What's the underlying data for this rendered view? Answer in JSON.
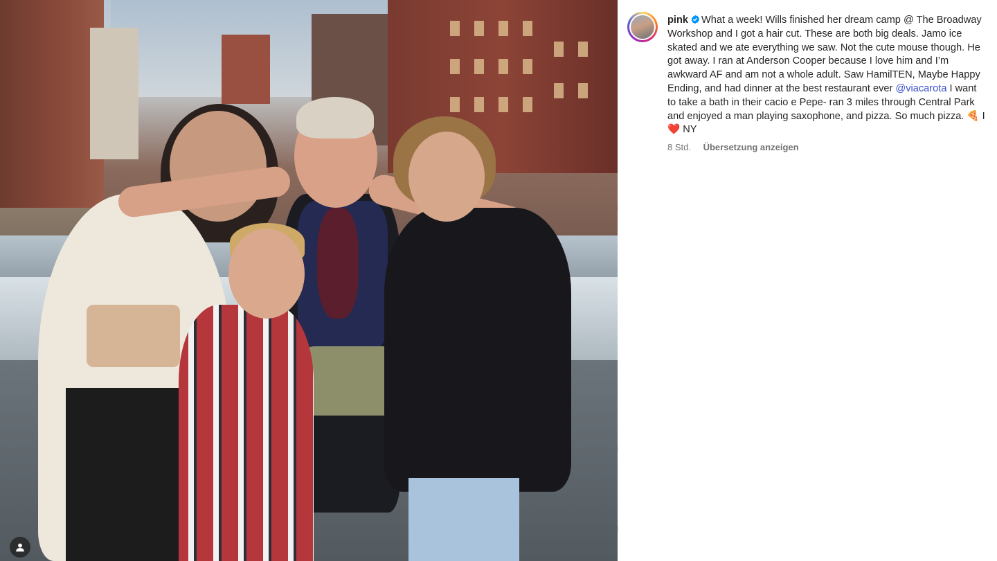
{
  "post": {
    "username": "pink",
    "verified": true,
    "caption_part1": "What a week! Wills finished her dream camp @ The Broadway Workshop and I got a hair cut. These are both big deals. Jamo ice skated and we ate everything we saw. Not the cute mouse though. He got away. I ran at Anderson Cooper because I love him and I’m awkward AF and am not a whole adult. Saw HamilTEN, Maybe Happy Ending, and had dinner at the best restaurant ever ",
    "mention": "@viacarota",
    "caption_part2": " I want to take a bath in their cacio e Pepe- ran 3 miles through Central Park and enjoyed a man playing saxophone, and pizza. So much pizza. ",
    "emoji_pizza": "🍕",
    "caption_i": " I ",
    "emoji_heart": "❤️",
    "caption_end": " NY",
    "timestamp": "8 Std.",
    "translate_label": "Übersetzung anzeigen"
  },
  "photo": {
    "tagged_user_icon": "person-icon"
  },
  "colors": {
    "verified": "#0095f6",
    "mention": "#3a50c9",
    "meta": "#737373",
    "text": "#262626"
  }
}
